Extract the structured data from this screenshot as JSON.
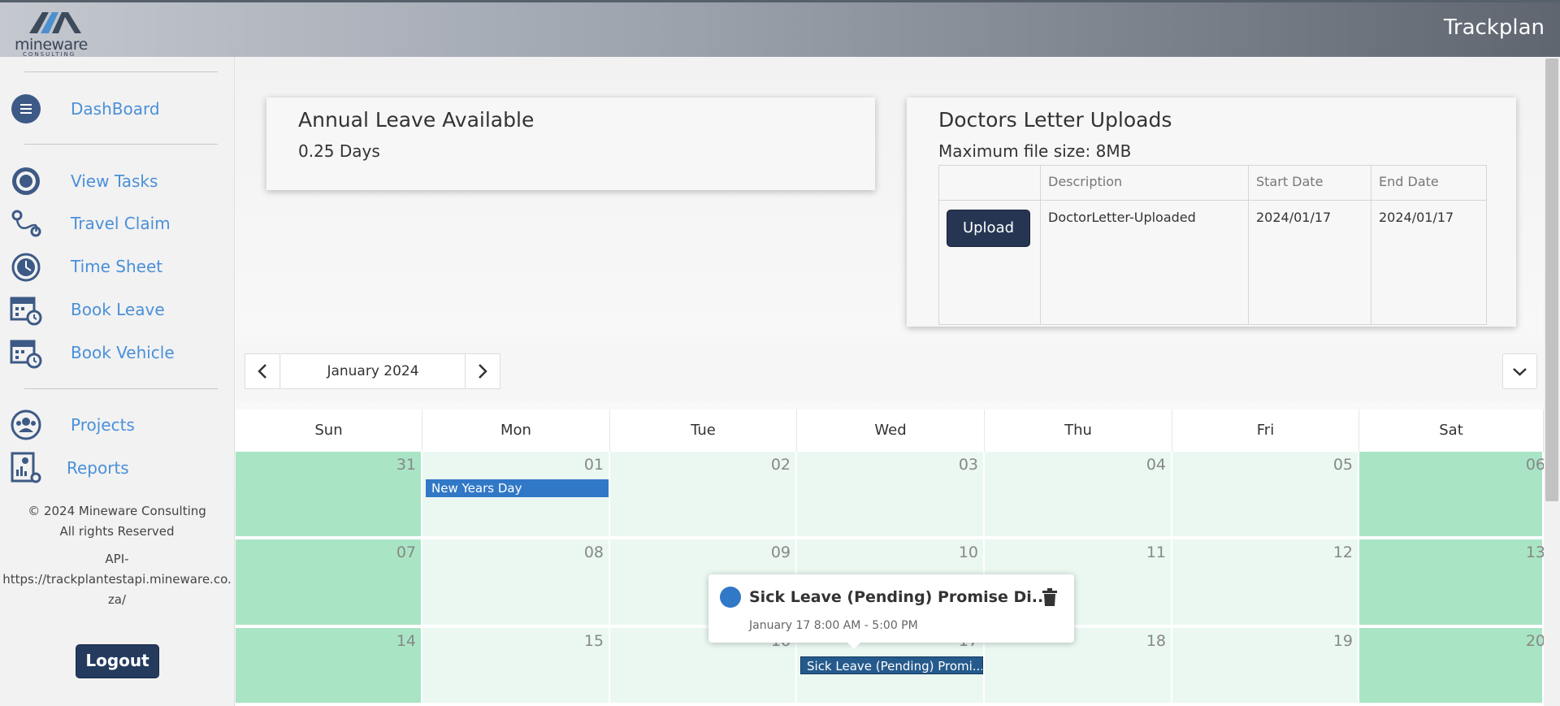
{
  "header": {
    "brand_word": "mineware",
    "brand_sub": "CONSULTING",
    "app_title": "Trackplan"
  },
  "sidebar": {
    "items": [
      {
        "label": "DashBoard",
        "icon": "menu-icon"
      },
      {
        "label": "View Tasks",
        "icon": "target-icon"
      },
      {
        "label": "Travel Claim",
        "icon": "route-icon"
      },
      {
        "label": "Time Sheet",
        "icon": "clock-icon"
      },
      {
        "label": "Book Leave",
        "icon": "calendar-clock-icon"
      },
      {
        "label": "Book Vehicle",
        "icon": "calendar-clock-icon"
      },
      {
        "label": "Projects",
        "icon": "team-icon"
      },
      {
        "label": "Reports",
        "icon": "report-icon"
      }
    ],
    "copyright": "© 2024 Mineware Consulting",
    "rights": "All rights Reserved",
    "api_label": "API-",
    "api_url_1": "https://trackplantestapi.mineware.co.",
    "api_url_2": "za/",
    "logout": "Logout"
  },
  "annual_leave": {
    "title": "Annual Leave Available",
    "value": "0.25 Days"
  },
  "doctors_letter": {
    "title": "Doctors Letter Uploads",
    "max_size": "Maximum file size: 8MB",
    "columns": [
      "",
      "Description",
      "Start Date",
      "End Date"
    ],
    "rows": [
      {
        "action": "Upload",
        "description": "DoctorLetter-Uploaded",
        "start": "2024/01/17",
        "end": "2024/01/17"
      }
    ]
  },
  "calendar": {
    "month_label": "January 2024",
    "weekdays": [
      "Sun",
      "Mon",
      "Tue",
      "Wed",
      "Thu",
      "Fri",
      "Sat"
    ],
    "weeks": [
      [
        "31",
        "01",
        "02",
        "03",
        "04",
        "05",
        "06"
      ],
      [
        "07",
        "08",
        "09",
        "10",
        "11",
        "12",
        "13"
      ],
      [
        "14",
        "15",
        "16",
        "17",
        "18",
        "19",
        "20"
      ]
    ],
    "events": {
      "holiday": "New Years Day",
      "sick_leave": "Sick Leave (Pending) Promi..."
    },
    "popup": {
      "title": "Sick Leave (Pending) Promise Di...",
      "time": "January 17 8:00 AM - 5:00 PM"
    },
    "colors": {
      "weekend": "#a9e5c5",
      "weekday": "#eaf8f1",
      "holiday": "#3178c6",
      "sick_leave": "#255a8c"
    }
  }
}
